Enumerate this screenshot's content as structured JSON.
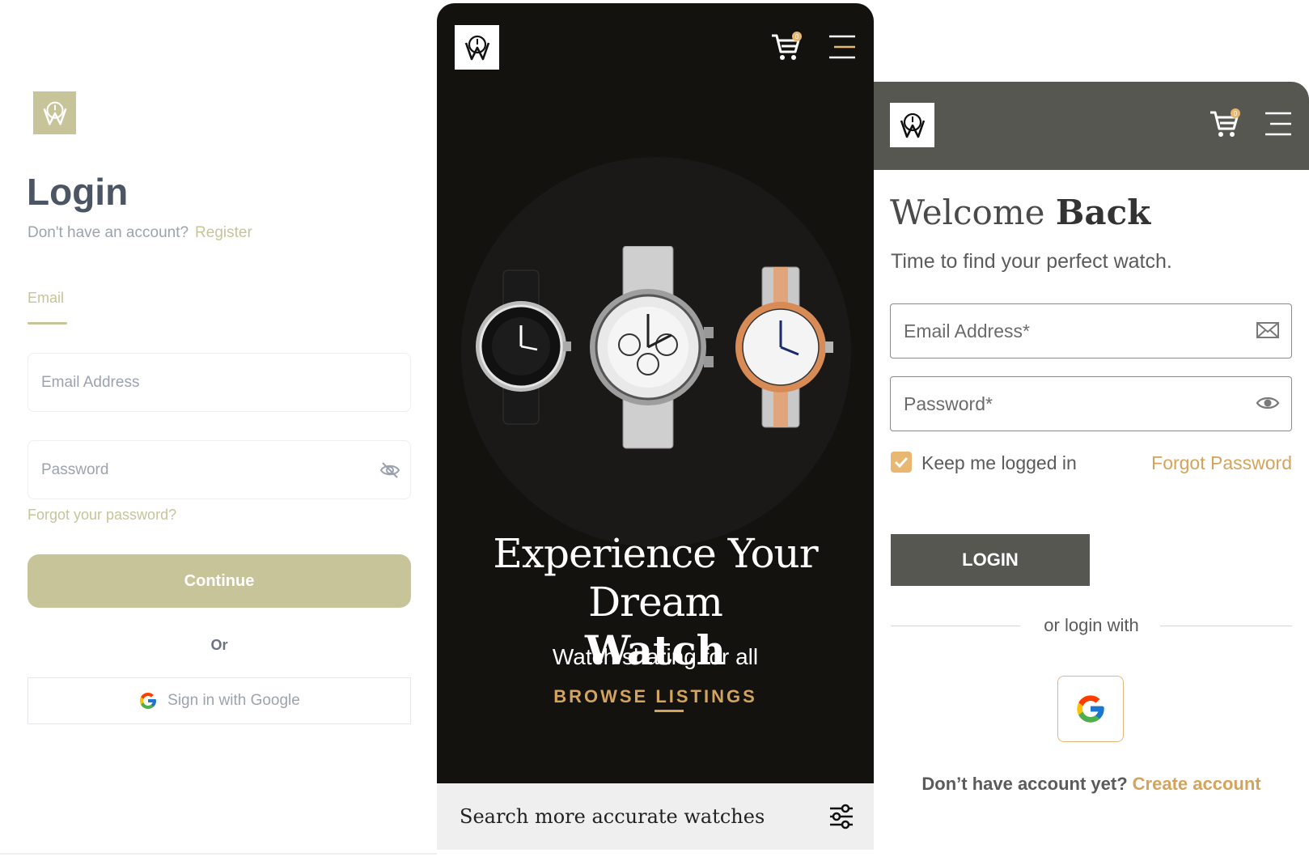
{
  "login_panel": {
    "title": "Login",
    "no_account_text": "Don't have an account?",
    "register_link": "Register",
    "tab_email": "Email",
    "email_placeholder": "Email Address",
    "password_placeholder": "Password",
    "forgot_link": "Forgot your password?",
    "continue_button": "Continue",
    "or_text": "Or",
    "google_button": "Sign in with Google",
    "accent_color": "#c8c49a"
  },
  "hero_panel": {
    "cart_count": "0",
    "headline_line1": "Experience Your Dream",
    "headline_line2": "Watch",
    "tagline": "Watch sharing for all",
    "browse_link": "BROWSE LISTINGS",
    "search_text": "Search more accurate watches",
    "background_color": "#14120f",
    "accent_color": "#d4a35c"
  },
  "welcome_panel": {
    "cart_count": "0",
    "welcome_light": "Welcome",
    "welcome_bold": "Back",
    "subtitle": "Time to find your perfect watch.",
    "email_placeholder": "Email Address*",
    "password_placeholder": "Password*",
    "keep_logged_in": "Keep me logged in",
    "forgot_link": "Forgot Password",
    "login_button": "LOGIN",
    "or_login_with": "or login with",
    "no_account_text": "Don’t have account yet?",
    "create_account_link": "Create account",
    "header_color": "#575752",
    "accent_color": "#d4a35c"
  },
  "icons": [
    "watch-logo-icon",
    "eye-off-icon",
    "google-icon",
    "cart-icon",
    "menu-icon",
    "filter-icon",
    "mail-icon",
    "eye-icon",
    "check-icon"
  ]
}
